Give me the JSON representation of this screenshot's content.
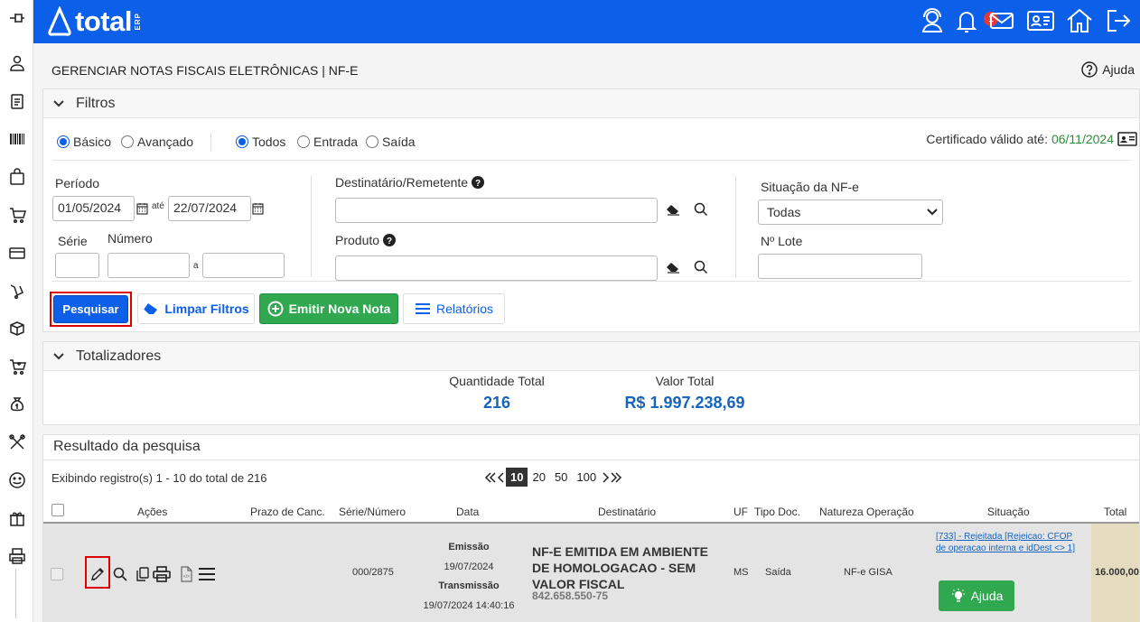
{
  "app": {
    "logo_text": "total",
    "logo_suffix": "ERP",
    "notification_count": "1"
  },
  "page": {
    "title": "GERENCIAR NOTAS FISCAIS ELETRÔNICAS | NF-E",
    "help_label": "Ajuda"
  },
  "filters": {
    "heading": "Filtros",
    "mode_options": [
      "Básico",
      "Avançado"
    ],
    "type_options": [
      "Todos",
      "Entrada",
      "Saída"
    ],
    "cert_label": "Certificado válido até:",
    "cert_date": "06/11/2024",
    "periodo_label": "Período",
    "date_from": "01/05/2024",
    "ate_label": "até",
    "date_to": "22/07/2024",
    "serie_label": "Série",
    "numero_label": "Número",
    "range_sep": "a",
    "destinatario_label": "Destinatário/Remetente",
    "produto_label": "Produto",
    "situacao_label": "Situação da NF-e",
    "situacao_value": "Todas",
    "lote_label": "Nº Lote"
  },
  "buttons": {
    "pesquisar": "Pesquisar",
    "limpar": "Limpar Filtros",
    "emitir": "Emitir Nova Nota",
    "relatorios": "Relatórios"
  },
  "totals": {
    "heading": "Totalizadores",
    "qty_label": "Quantidade Total",
    "qty_value": "216",
    "value_label": "Valor Total",
    "value_value": "R$ 1.997.238,69"
  },
  "results": {
    "heading": "Resultado da pesquisa",
    "info": "Exibindo registro(s) 1 - 10 do total de 216",
    "page_sizes": [
      "10",
      "20",
      "50",
      "100"
    ],
    "columns": [
      "Ações",
      "Prazo de Canc.",
      "Série/Número",
      "Data",
      "Destinatário",
      "UF",
      "Tipo Doc.",
      "Natureza Operação",
      "Situação",
      "Total"
    ],
    "rows": [
      {
        "serie_numero": "000/2875",
        "emissao_label": "Emissão",
        "emissao": "19/07/2024",
        "transmissao_label": "Transmissão",
        "transmissao": "19/07/2024 14:40:16",
        "destinatario": "NF-E EMITIDA EM AMBIENTE DE HOMOLOGACAO - SEM VALOR FISCAL",
        "doc": "842.658.550-75",
        "uf": "MS",
        "tipo": "Saída",
        "natureza": "NF-e GISA",
        "situacao": "[733] - Rejeitada [Rejeicao: CFOP de operacao interna e idDest <> 1]",
        "ajuda": "Ajuda",
        "total": "16.000,00"
      }
    ]
  },
  "colors": {
    "primary": "#0b5fe8",
    "success": "#2fa84f",
    "cert_date": "#2e8b3a",
    "highlight": "#dd0000"
  }
}
